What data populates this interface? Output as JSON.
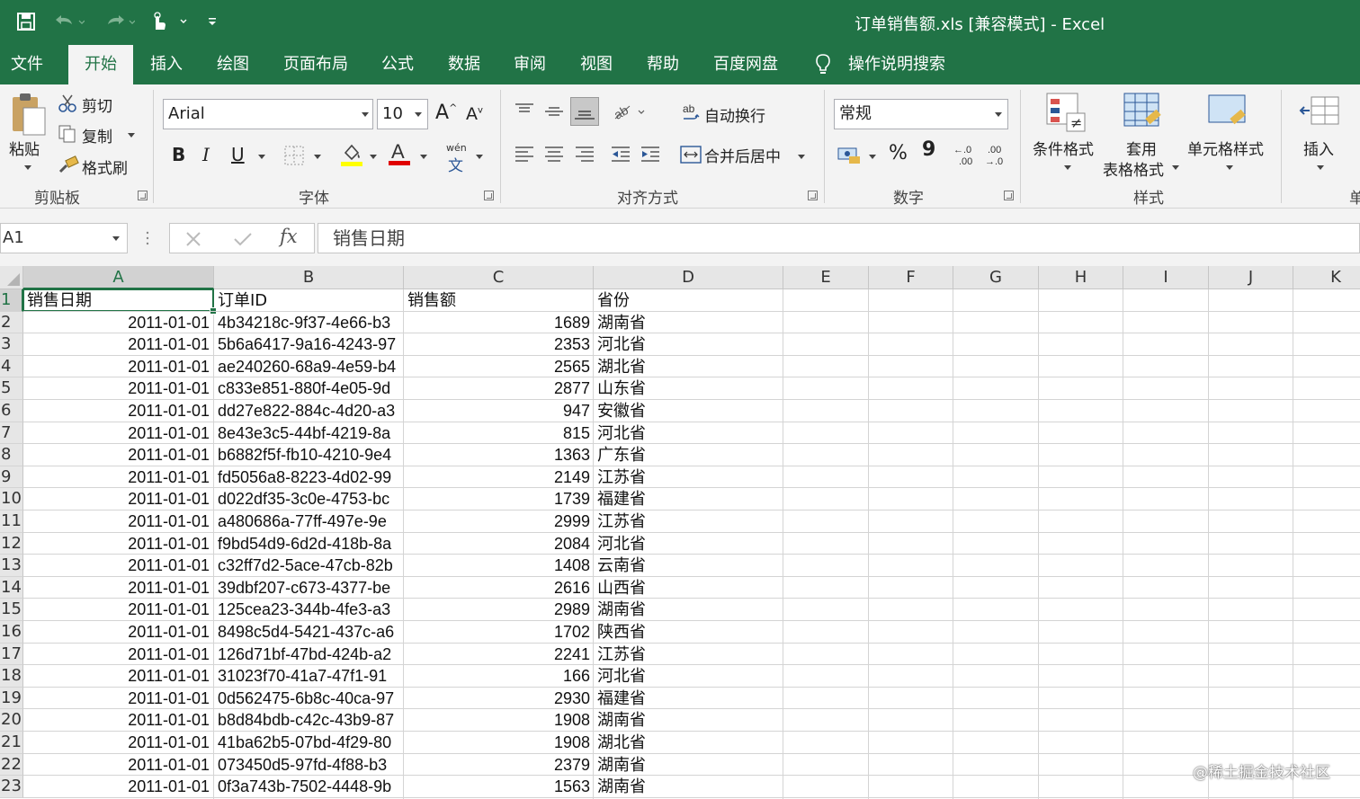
{
  "window": {
    "title": "订单销售额.xls  [兼容模式]  -  Excel"
  },
  "colors": {
    "brand_green": "#217346",
    "ribbon_bg": "#f3f3f3"
  },
  "tabs": [
    {
      "label": "文件"
    },
    {
      "label": "开始"
    },
    {
      "label": "插入"
    },
    {
      "label": "绘图"
    },
    {
      "label": "页面布局"
    },
    {
      "label": "公式"
    },
    {
      "label": "数据"
    },
    {
      "label": "审阅"
    },
    {
      "label": "视图"
    },
    {
      "label": "帮助"
    },
    {
      "label": "百度网盘"
    }
  ],
  "tell_me": {
    "label": "操作说明搜索",
    "icon": "lightbulb-icon"
  },
  "ribbon": {
    "clipboard": {
      "paste": "粘贴",
      "cut": "剪切",
      "copy": "复制",
      "format_painter": "格式刷",
      "group": "剪贴板"
    },
    "font": {
      "name": "Arial",
      "size": "10",
      "bold": "B",
      "italic": "I",
      "underline": "U",
      "phonetic_top": "wén",
      "phonetic_bottom": "文",
      "group": "字体"
    },
    "alignment": {
      "wrap_text": "自动换行",
      "merge_center": "合并后居中",
      "group": "对齐方式"
    },
    "number": {
      "format": "常规",
      "percent": "%",
      "comma": "9",
      "group": "数字"
    },
    "styles": {
      "conditional": "条件格式",
      "format_table_line1": "套用",
      "format_table_line2": "表格格式",
      "cell_styles": "单元格样式",
      "group": "样式"
    },
    "cells": {
      "insert": "插入",
      "group_partial": "单"
    }
  },
  "formula_bar": {
    "name_box": "A1",
    "fx": "fx",
    "value": "销售日期"
  },
  "grid": {
    "columns": [
      "A",
      "B",
      "C",
      "D",
      "E",
      "F",
      "G",
      "H",
      "I",
      "J",
      "K"
    ],
    "header_row": [
      "销售日期",
      "订单ID",
      "销售额",
      "省份"
    ],
    "rows": [
      {
        "n": "2",
        "date": "2011-01-01",
        "id": "4b34218c-9f37-4e66-b3",
        "amount": "1689",
        "province": "湖南省"
      },
      {
        "n": "3",
        "date": "2011-01-01",
        "id": "5b6a6417-9a16-4243-97",
        "amount": "2353",
        "province": "河北省"
      },
      {
        "n": "4",
        "date": "2011-01-01",
        "id": "ae240260-68a9-4e59-b4",
        "amount": "2565",
        "province": "湖北省"
      },
      {
        "n": "5",
        "date": "2011-01-01",
        "id": "c833e851-880f-4e05-9d",
        "amount": "2877",
        "province": "山东省"
      },
      {
        "n": "6",
        "date": "2011-01-01",
        "id": "dd27e822-884c-4d20-a3",
        "amount": "947",
        "province": "安徽省"
      },
      {
        "n": "7",
        "date": "2011-01-01",
        "id": "8e43e3c5-44bf-4219-8a",
        "amount": "815",
        "province": "河北省"
      },
      {
        "n": "8",
        "date": "2011-01-01",
        "id": "b6882f5f-fb10-4210-9e4",
        "amount": "1363",
        "province": "广东省"
      },
      {
        "n": "9",
        "date": "2011-01-01",
        "id": "fd5056a8-8223-4d02-99",
        "amount": "2149",
        "province": "江苏省"
      },
      {
        "n": "10",
        "date": "2011-01-01",
        "id": "d022df35-3c0e-4753-bc",
        "amount": "1739",
        "province": "福建省"
      },
      {
        "n": "11",
        "date": "2011-01-01",
        "id": "a480686a-77ff-497e-9e",
        "amount": "2999",
        "province": "江苏省"
      },
      {
        "n": "12",
        "date": "2011-01-01",
        "id": "f9bd54d9-6d2d-418b-8a",
        "amount": "2084",
        "province": "河北省"
      },
      {
        "n": "13",
        "date": "2011-01-01",
        "id": "c32ff7d2-5ace-47cb-82b",
        "amount": "1408",
        "province": "云南省"
      },
      {
        "n": "14",
        "date": "2011-01-01",
        "id": "39dbf207-c673-4377-be",
        "amount": "2616",
        "province": "山西省"
      },
      {
        "n": "15",
        "date": "2011-01-01",
        "id": "125cea23-344b-4fe3-a3",
        "amount": "2989",
        "province": "湖南省"
      },
      {
        "n": "16",
        "date": "2011-01-01",
        "id": "8498c5d4-5421-437c-a6",
        "amount": "1702",
        "province": "陕西省"
      },
      {
        "n": "17",
        "date": "2011-01-01",
        "id": "126d71bf-47bd-424b-a2",
        "amount": "2241",
        "province": "江苏省"
      },
      {
        "n": "18",
        "date": "2011-01-01",
        "id": "31023f70-41a7-47f1-91",
        "amount": "166",
        "province": "河北省"
      },
      {
        "n": "19",
        "date": "2011-01-01",
        "id": "0d562475-6b8c-40ca-97",
        "amount": "2930",
        "province": "福建省"
      },
      {
        "n": "20",
        "date": "2011-01-01",
        "id": "b8d84bdb-c42c-43b9-87",
        "amount": "1908",
        "province": "湖南省"
      },
      {
        "n": "21",
        "date": "2011-01-01",
        "id": "41ba62b5-07bd-4f29-80",
        "amount": "1908",
        "province": "湖北省"
      },
      {
        "n": "22",
        "date": "2011-01-01",
        "id": "073450d5-97fd-4f88-b3",
        "amount": "2379",
        "province": "湖南省"
      },
      {
        "n": "23",
        "date": "2011-01-01",
        "id": "0f3a743b-7502-4448-9b",
        "amount": "1563",
        "province": "湖南省"
      }
    ]
  },
  "watermark": "@稀土掘金技术社区"
}
